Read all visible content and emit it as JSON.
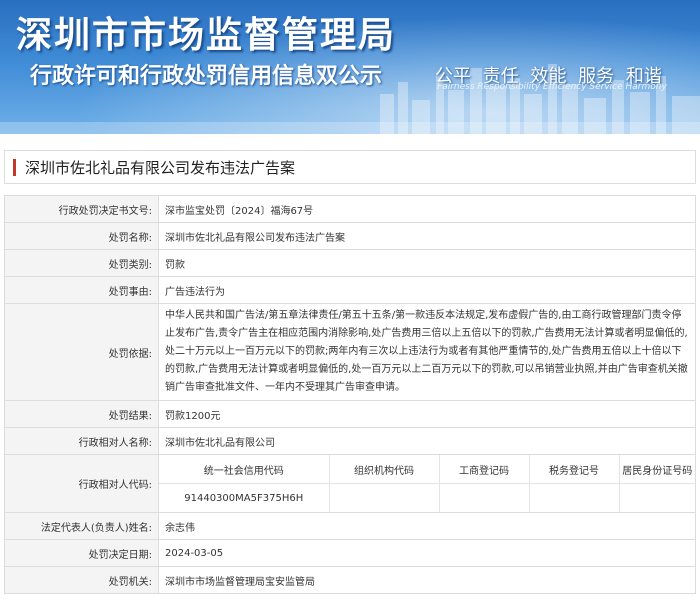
{
  "banner": {
    "title": "深圳市市场监督管理局",
    "subtitle": "行政许可和行政处罚信用信息双公示",
    "slogan": "公平 责任 效能 服务 和谐",
    "slogan_en": "Fairness Responsibility Efficiency Service Harmony"
  },
  "case_title": "深圳市佐北礼品有限公司发布违法广告案",
  "labels": {
    "decision_no": "行政处罚决定书文号:",
    "case_name": "处罚名称:",
    "category": "处罚类别:",
    "reason": "处罚事由:",
    "basis": "处罚依据:",
    "result": "处罚结果:",
    "party_name": "行政相对人名称:",
    "party_code": "行政相对人代码:",
    "legal_rep": "法定代表人(负责人)姓名:",
    "decision_date": "处罚决定日期:",
    "authority": "处罚机关:"
  },
  "values": {
    "decision_no": "深市监宝处罚〔2024〕福海67号",
    "case_name": "深圳市佐北礼品有限公司发布违法广告案",
    "category": "罚款",
    "reason": "广告违法行为",
    "basis": "中华人民共和国广告法/第五章法律责任/第五十五条/第一款违反本法规定,发布虚假广告的,由工商行政管理部门责令停止发布广告,责令广告主在相应范围内消除影响,处广告费用三倍以上五倍以下的罚款,广告费用无法计算或者明显偏低的,处二十万元以上一百万元以下的罚款;两年内有三次以上违法行为或者有其他严重情节的,处广告费用五倍以上十倍以下的罚款,广告费用无法计算或者明显偏低的,处一百万元以上二百万元以下的罚款,可以吊销营业执照,并由广告审查机关撤销广告审查批准文件、一年内不受理其广告审查申请。",
    "result": "罚款1200元",
    "party_name": "深圳市佐北礼品有限公司",
    "legal_rep": "余志伟",
    "decision_date": "2024-03-05",
    "authority": "深圳市市场监督管理局宝安监管局"
  },
  "party_code": {
    "headers": [
      "统一社会信用代码",
      "组织机构代码",
      "工商登记码",
      "税务登记号",
      "居民身份证号码"
    ],
    "values": [
      "91440300MA5F375H6H",
      "",
      "",
      "",
      ""
    ]
  }
}
